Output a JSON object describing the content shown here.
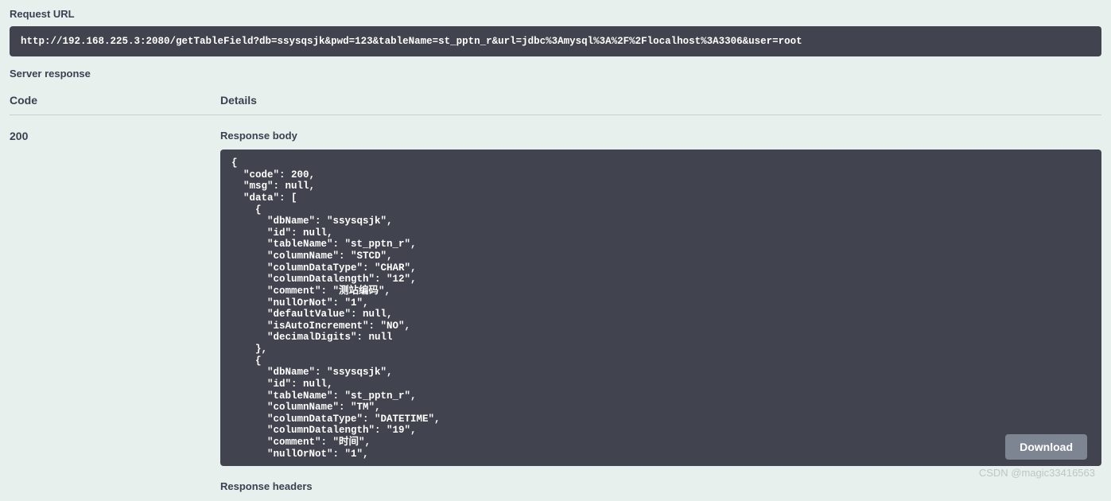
{
  "labels": {
    "request_url": "Request URL",
    "server_response": "Server response",
    "code_header": "Code",
    "details_header": "Details",
    "response_body": "Response body",
    "response_headers": "Response headers",
    "download": "Download"
  },
  "request": {
    "url": "http://192.168.225.3:2080/getTableField?db=ssysqsjk&pwd=123&tableName=st_pptn_r&url=jdbc%3Amysql%3A%2F%2Flocalhost%3A3306&user=root"
  },
  "response": {
    "code": "200",
    "body": "{\n  \"code\": 200,\n  \"msg\": null,\n  \"data\": [\n    {\n      \"dbName\": \"ssysqsjk\",\n      \"id\": null,\n      \"tableName\": \"st_pptn_r\",\n      \"columnName\": \"STCD\",\n      \"columnDataType\": \"CHAR\",\n      \"columnDatalength\": \"12\",\n      \"comment\": \"测站编码\",\n      \"nullOrNot\": \"1\",\n      \"defaultValue\": null,\n      \"isAutoIncrement\": \"NO\",\n      \"decimalDigits\": null\n    },\n    {\n      \"dbName\": \"ssysqsjk\",\n      \"id\": null,\n      \"tableName\": \"st_pptn_r\",\n      \"columnName\": \"TM\",\n      \"columnDataType\": \"DATETIME\",\n      \"columnDatalength\": \"19\",\n      \"comment\": \"时间\",\n      \"nullOrNot\": \"1\","
  },
  "watermark": "CSDN @magic33416563"
}
